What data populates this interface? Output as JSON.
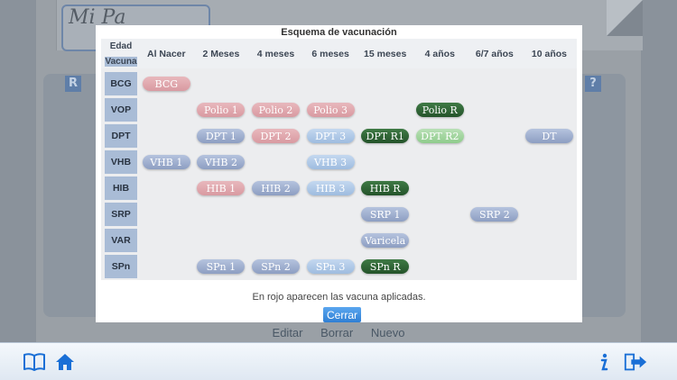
{
  "background": {
    "logo_text": "Mi Pa",
    "actions": [
      "Editar",
      "Borrar",
      "Nuevo"
    ],
    "icon_left": "R",
    "icon_right": "?"
  },
  "modal": {
    "title": "Esquema de vacunación",
    "corner_top": "Edad",
    "corner_bottom": "Vacuna",
    "columns": [
      "Al Nacer",
      "2 Meses",
      "4 meses",
      "6 meses",
      "15 meses",
      "4 años",
      "6/7 años",
      "10 años"
    ],
    "rows": [
      {
        "label": "BCG",
        "pills": [
          {
            "col": 0,
            "text": "BCG",
            "color": "red"
          }
        ]
      },
      {
        "label": "VOP",
        "pills": [
          {
            "col": 1,
            "text": "Polio 1",
            "color": "red"
          },
          {
            "col": 2,
            "text": "Polio 2",
            "color": "red"
          },
          {
            "col": 3,
            "text": "Polio 3",
            "color": "red"
          },
          {
            "col": 5,
            "text": "Polio R",
            "color": "dgreen"
          }
        ]
      },
      {
        "label": "DPT",
        "pills": [
          {
            "col": 1,
            "text": "DPT 1",
            "color": "blue"
          },
          {
            "col": 2,
            "text": "DPT 2",
            "color": "red"
          },
          {
            "col": 3,
            "text": "DPT 3",
            "color": "lblue"
          },
          {
            "col": 4,
            "text": "DPT R1",
            "color": "dgreen"
          },
          {
            "col": 5,
            "text": "DPT R2",
            "color": "lgreen"
          },
          {
            "col": 7,
            "text": "DT",
            "color": "blue"
          }
        ]
      },
      {
        "label": "VHB",
        "pills": [
          {
            "col": 0,
            "text": "VHB 1",
            "color": "blue"
          },
          {
            "col": 1,
            "text": "VHB 2",
            "color": "blue"
          },
          {
            "col": 3,
            "text": "VHB 3",
            "color": "lblue"
          }
        ]
      },
      {
        "label": "HIB",
        "pills": [
          {
            "col": 1,
            "text": "HIB 1",
            "color": "red"
          },
          {
            "col": 2,
            "text": "HIB 2",
            "color": "blue"
          },
          {
            "col": 3,
            "text": "HIB 3",
            "color": "lblue"
          },
          {
            "col": 4,
            "text": "HIB R",
            "color": "dgreen"
          }
        ]
      },
      {
        "label": "SRP",
        "pills": [
          {
            "col": 4,
            "text": "SRP 1",
            "color": "blue"
          },
          {
            "col": 6,
            "text": "SRP 2",
            "color": "blue"
          }
        ]
      },
      {
        "label": "VAR",
        "pills": [
          {
            "col": 4,
            "text": "Varicela",
            "color": "blue"
          }
        ]
      },
      {
        "label": "SPn",
        "pills": [
          {
            "col": 1,
            "text": "SPn 1",
            "color": "blue"
          },
          {
            "col": 2,
            "text": "SPn 2",
            "color": "blue"
          },
          {
            "col": 3,
            "text": "SPn 3",
            "color": "lblue"
          },
          {
            "col": 4,
            "text": "SPn R",
            "color": "dgreen"
          }
        ]
      }
    ],
    "note": "En rojo aparecen las vacuna aplicadas.",
    "close_label": "Cerrar"
  },
  "toolbar": {
    "left_icons": [
      "book-icon",
      "home-icon"
    ],
    "right_icons": [
      "info-icon",
      "exit-icon"
    ],
    "accent_color": "#1a6fd6"
  }
}
